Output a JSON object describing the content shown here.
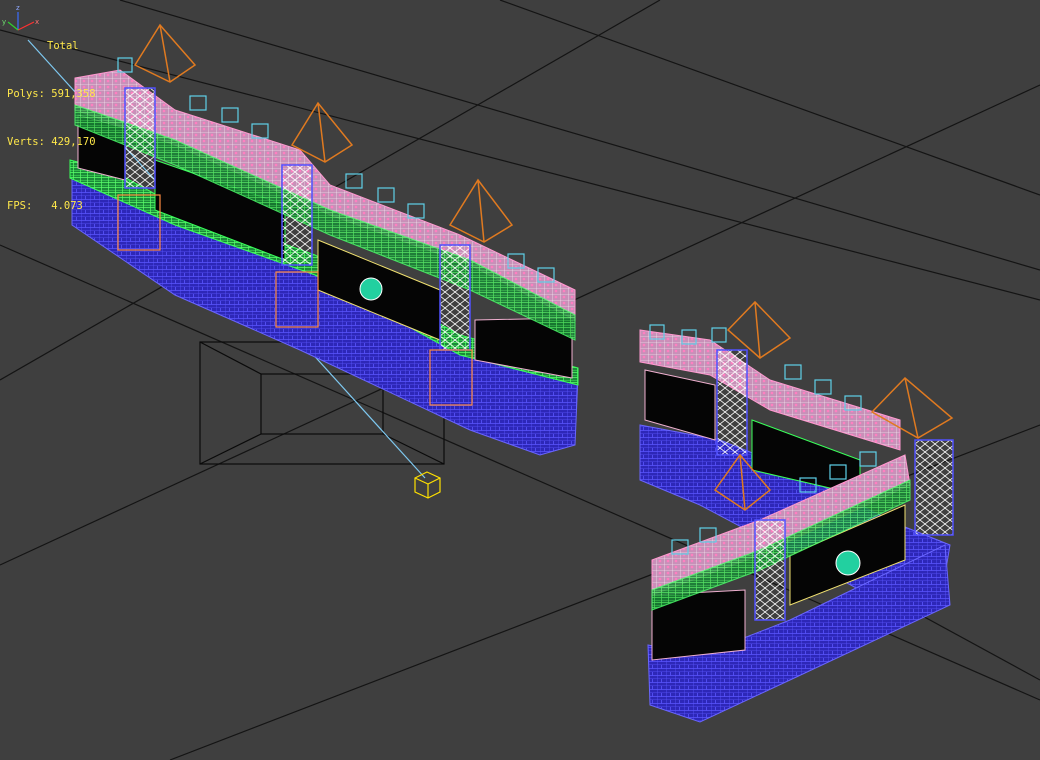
{
  "viewport": {
    "name": "perspective-viewport",
    "background": "#3f3f3f",
    "grid_color": "#111111"
  },
  "stats": {
    "title": "Total",
    "polys_label": "Polys:",
    "polys_value": "591,358",
    "verts_label": "Verts:",
    "verts_value": "429,170",
    "fps_label": "FPS:",
    "fps_value": "4.073"
  },
  "objects": [
    {
      "name": "castle-wall-left",
      "type": "wireframe-model"
    },
    {
      "name": "castle-wall-right",
      "type": "wireframe-model"
    },
    {
      "name": "camera-object",
      "type": "camera"
    },
    {
      "name": "light-helper",
      "type": "helper",
      "color": "#ffe000"
    }
  ],
  "colors": {
    "base_blue": "#3a2fe0",
    "green": "#22c84a",
    "pink": "#f0a8c8",
    "cyan": "#5ed0e8",
    "orange": "#e07a20",
    "stats_text": "#ffe84a"
  },
  "axis_gizmo": {
    "x_label": "x",
    "y_label": "y",
    "z_label": "z"
  }
}
